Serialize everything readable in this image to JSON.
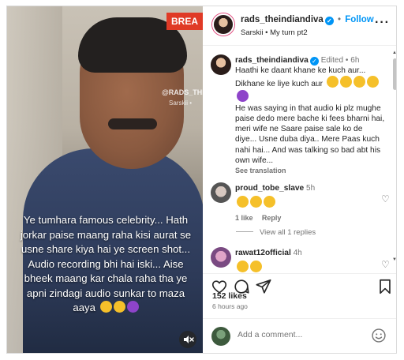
{
  "post": {
    "username": "rads_theindiandiva",
    "follow_label": "Follow",
    "dot": "•",
    "audio_artist": "Sarskii",
    "audio_title": "My turn pt2",
    "subtitle_sep": "•",
    "more_icon": "more-horizontal-icon",
    "video_brand_tag": "BREA",
    "video_watermark_user": "@RADS_THEI",
    "video_watermark_audio": "Sarskii •",
    "video_caption": "Ye tumhara famous celebrity... Hath jorkar paise maang raha kisi aurat se usne share kiya hai ye screen shot... Audio recording bhi hai iski... Aise bheek maang kar chala raha tha ye apni zindagi audio sunkar to maza aaya"
  },
  "caption": {
    "username": "rads_theindiandiva",
    "edited": "Edited",
    "time": "6h",
    "line1": "Haathi ke daant khane ke kuch aur... Dikhane ke liye kuch aur",
    "body": "He was saying in that audio ki plz mughe paise dedo mere bache ki fees bharni hai, meri wife ne Saare paise sale ko de diye... Usne duba diya.. Mere Paas kuch nahi hai... And was talking so bad abt his own wife...",
    "see_translation": "See translation"
  },
  "comments": [
    {
      "username": "proud_tobe_slave",
      "time": "5h",
      "likes_label": "1 like",
      "reply_label": "Reply",
      "view_replies": "View all 1 replies"
    },
    {
      "username": "rawat12official",
      "time": "4h"
    }
  ],
  "likes": "152 likes",
  "time_ago": "6 hours ago",
  "add_comment_placeholder": "Add a comment...",
  "colors": {
    "accent": "#0095f6",
    "text": "#262626",
    "muted": "#737373",
    "brand_tag": "#e03a26"
  }
}
